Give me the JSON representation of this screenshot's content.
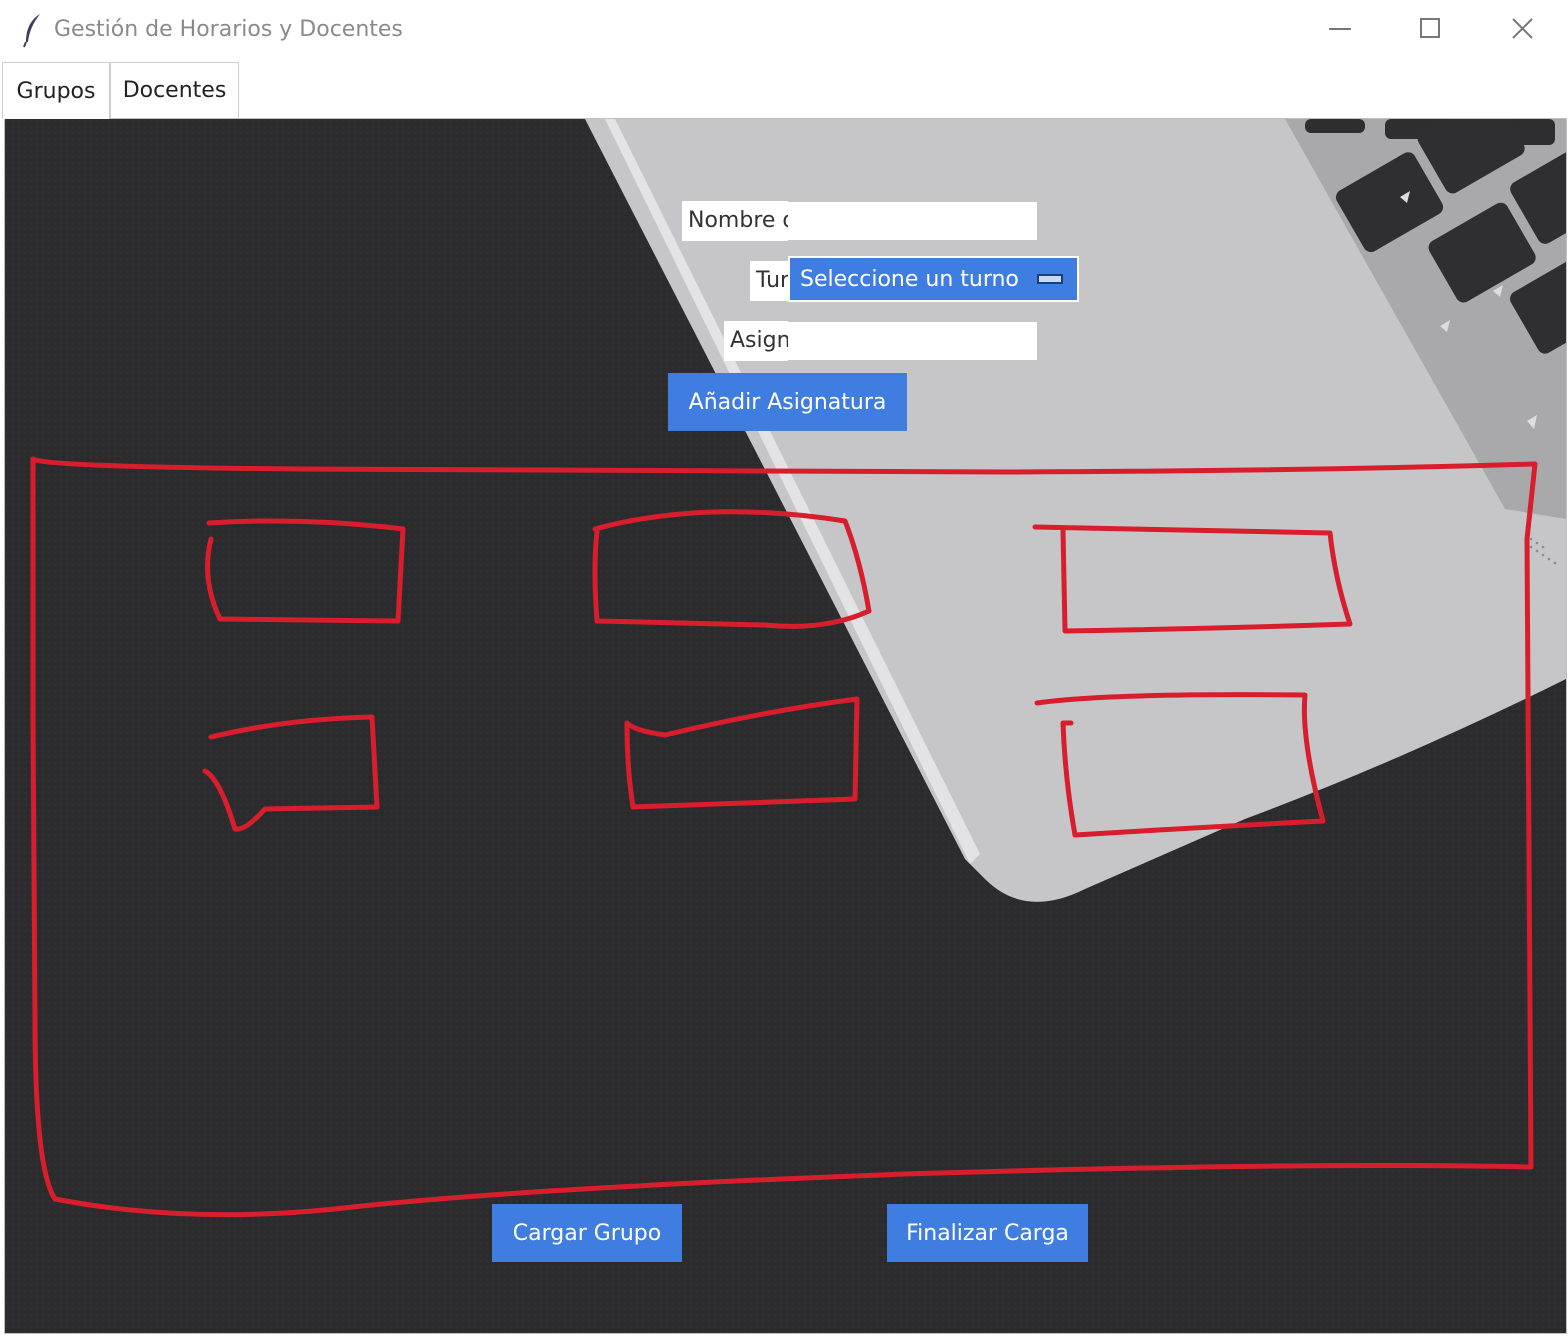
{
  "window": {
    "title": "Gestión de Horarios y Docentes",
    "app_icon": "feather-icon",
    "controls": [
      "minimize-icon",
      "maximize-icon",
      "close-icon"
    ]
  },
  "tabs": [
    {
      "label": "Grupos",
      "active": true
    },
    {
      "label": "Docentes",
      "active": false
    }
  ],
  "form": {
    "nombre_label": "Nombre d",
    "nombre_value": "",
    "turno_label": "Turno",
    "turno_selected": "Seleccione un turno",
    "asignatura_label": "Asignatura",
    "asignatura_value": "",
    "add_button": "Añadir Asignatura"
  },
  "footer": {
    "load_button": "Cargar Grupo",
    "finish_button": "Finalizar Carga"
  },
  "colors": {
    "accent": "#3f7ee0",
    "annotation": "#d81e2c",
    "background": "#2b2b2d",
    "laptop": "#c9c9c9"
  }
}
